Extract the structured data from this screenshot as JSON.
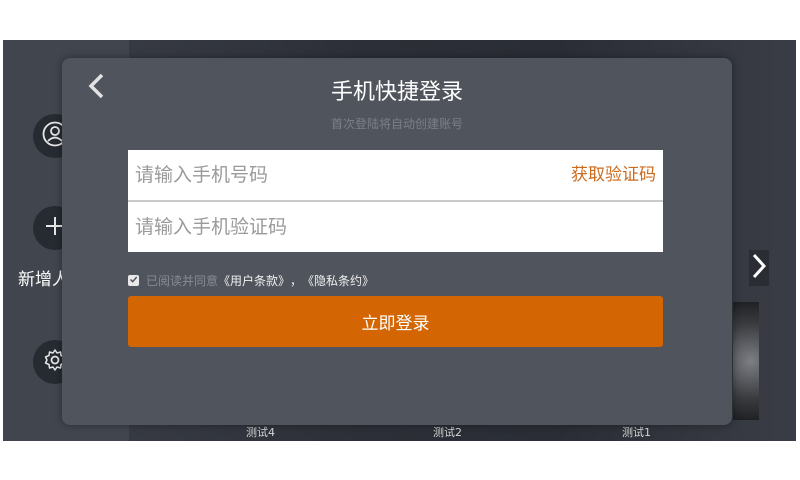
{
  "background": {
    "sidebar": {
      "add_label": "新增人"
    },
    "thumbnails": [
      {
        "label": "测试4"
      },
      {
        "label": "测试2"
      },
      {
        "label": "测试1"
      }
    ]
  },
  "modal": {
    "title": "手机快捷登录",
    "subtitle": "首次登陆将自动创建账号",
    "phone_placeholder": "请输入手机号码",
    "get_code_label": "获取验证码",
    "code_placeholder": "请输入手机验证码",
    "agree_text": "已阅读并同意",
    "user_terms": "《用户条款》",
    "separator": "，",
    "privacy_terms": "《隐私条约》",
    "agree_checked": true,
    "login_label": "立即登录"
  },
  "colors": {
    "accent": "#d36503",
    "link": "#cc6a1d",
    "modal_bg": "#50545c"
  }
}
